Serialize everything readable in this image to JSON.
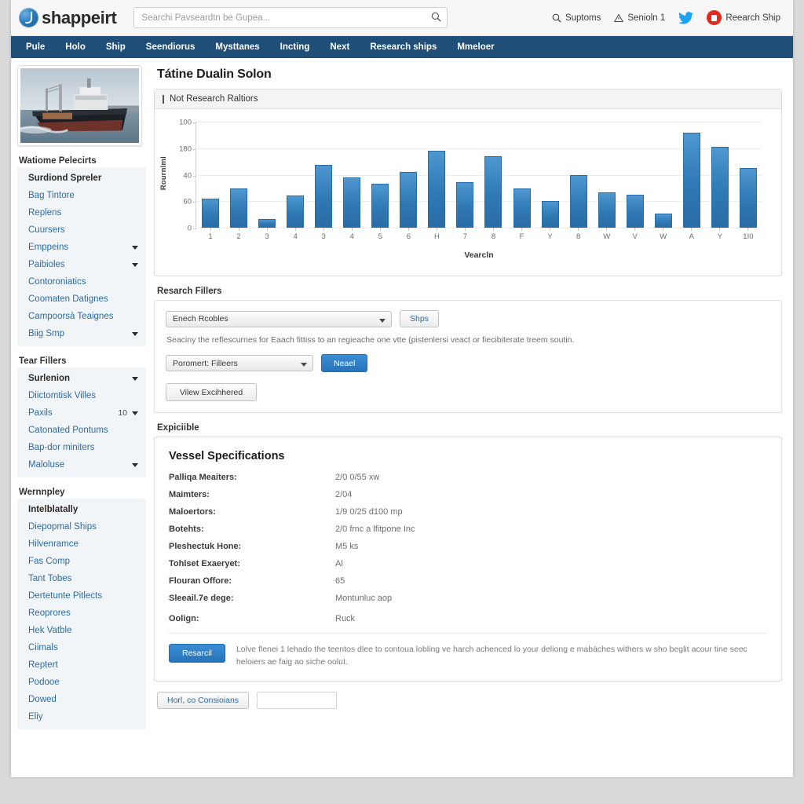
{
  "header": {
    "brand": "shappeirt",
    "search_placeholder": "Searchi Pavseardtn be Gupea...",
    "right_items": [
      {
        "icon": "search-icon",
        "label": "Suptoms"
      },
      {
        "icon": "alert-icon",
        "label": "Senioln 1"
      },
      {
        "icon": "twitter-icon",
        "label": ""
      },
      {
        "icon": "avatar-icon",
        "label": "Reearch Ship"
      }
    ]
  },
  "nav": {
    "items": [
      "Pule",
      "Holo",
      "Ship",
      "Seendiorus",
      "Mysttanes",
      "Incting",
      "Next",
      "Research ships",
      "Mmeloer"
    ]
  },
  "sidebar": {
    "thumbnail_alt": "cargo-ship-photo",
    "groups": [
      {
        "title": "Watiome Pelecirts",
        "items": [
          {
            "label": "Surdiond Spreler",
            "active": true,
            "caret": false,
            "badge": ""
          },
          {
            "label": "Bag Tintore",
            "active": false,
            "caret": false,
            "badge": ""
          },
          {
            "label": "Replens",
            "active": false,
            "caret": false,
            "badge": ""
          },
          {
            "label": "Cuursers",
            "active": false,
            "caret": false,
            "badge": ""
          },
          {
            "label": "Emppeins",
            "active": false,
            "caret": true,
            "badge": ""
          },
          {
            "label": "Paibioles",
            "active": false,
            "caret": true,
            "badge": ""
          },
          {
            "label": "Contoroniatics",
            "active": false,
            "caret": false,
            "badge": ""
          },
          {
            "label": "Coomaten Datignes",
            "active": false,
            "caret": false,
            "badge": ""
          },
          {
            "label": "Campoorsà Teaignes",
            "active": false,
            "caret": false,
            "badge": ""
          },
          {
            "label": "Biig Smp",
            "active": false,
            "caret": true,
            "badge": ""
          }
        ]
      },
      {
        "title": "Tear Fillers",
        "items": [
          {
            "label": "Surlenion",
            "active": true,
            "caret": true,
            "badge": ""
          },
          {
            "label": "Diictomtisk Villes",
            "active": false,
            "caret": false,
            "badge": ""
          },
          {
            "label": "Paxils",
            "active": false,
            "caret": true,
            "badge": "10"
          },
          {
            "label": "Catonated Pontums",
            "active": false,
            "caret": false,
            "badge": ""
          },
          {
            "label": "Bap-dor miniters",
            "active": false,
            "caret": false,
            "badge": ""
          },
          {
            "label": "Maloluse",
            "active": false,
            "caret": true,
            "badge": ""
          }
        ]
      },
      {
        "title": "Wernnpley",
        "items": [
          {
            "label": "Intelblatally",
            "active": true,
            "caret": false,
            "badge": ""
          },
          {
            "label": "Diepopmal Ships",
            "active": false,
            "caret": false,
            "badge": ""
          },
          {
            "label": "Hilvenramce",
            "active": false,
            "caret": false,
            "badge": ""
          },
          {
            "label": "Fas Comp",
            "active": false,
            "caret": false,
            "badge": ""
          },
          {
            "label": "Tant Tobes",
            "active": false,
            "caret": false,
            "badge": ""
          },
          {
            "label": "Dertetunte Pitlects",
            "active": false,
            "caret": false,
            "badge": ""
          },
          {
            "label": "Reoprores",
            "active": false,
            "caret": false,
            "badge": ""
          },
          {
            "label": "Hek Vatble",
            "active": false,
            "caret": false,
            "badge": ""
          },
          {
            "label": "Ciimals",
            "active": false,
            "caret": false,
            "badge": ""
          },
          {
            "label": "Reptert",
            "active": false,
            "caret": false,
            "badge": ""
          },
          {
            "label": "Podooe",
            "active": false,
            "caret": false,
            "badge": ""
          },
          {
            "label": "Dowed",
            "active": false,
            "caret": false,
            "badge": ""
          },
          {
            "label": "Eliy",
            "active": false,
            "caret": false,
            "badge": ""
          }
        ]
      }
    ]
  },
  "main": {
    "page_title": "Tátine Dualin Solon",
    "chart_panel_title": "Not Research Raltiors",
    "filters_title": "Resarch Fillers",
    "filters": {
      "select1": "Enech Rcobles",
      "button1": "Shps",
      "help": "Seaciny the reflescurries for Eaach fittiss to an regieache one vtte (pistenlersi veact or fiecibiterate treem soutin.",
      "select2": "Poromert: Filleers",
      "button2": "Neael",
      "button3": "Vilew Excihhered"
    },
    "expand_title": "Expiciible",
    "specs": {
      "heading": "Vessel Specifications",
      "rows": [
        {
          "key": "Palliqa Meaiters:",
          "value": "2/0 0/55 xw"
        },
        {
          "key": "Maimters:",
          "value": "2/04"
        },
        {
          "key": "Maloertors:",
          "value": "1/9 0/25 d100 mp"
        },
        {
          "key": "Botehts:",
          "value": "2/0 fmc a lfitpone Inc"
        },
        {
          "key": "Pleshectuk Hone:",
          "value": "M5 ks"
        },
        {
          "key": "Tohlset Exaeryet:",
          "value": "Al"
        },
        {
          "key": "Flouran Offore:",
          "value": "65"
        },
        {
          "key": "Sleeail.7e dege:",
          "value": "Montunluc aop"
        },
        {
          "key": "Oolign:",
          "value": "Ruck"
        }
      ]
    },
    "cta": {
      "button": "Resarcil",
      "text": "Lolve flenei 1 lehado the teentos dlee to contoua lobling ve harch achenced lo your deliong e mabàches withers w sho beglit acour tine seec heloiers ae faig ao siche ooluI."
    },
    "footer": {
      "button": "Horl, co Consioians",
      "input_value": ""
    }
  },
  "chart_data": {
    "type": "bar",
    "title": "Not Research Raltiors",
    "xlabel": "Vearcln",
    "ylabel": "Rournlml",
    "categories": [
      "1",
      "2",
      "3",
      "4",
      "3",
      "4",
      "5",
      "6",
      "H",
      "7",
      "8",
      "F",
      "Y",
      "8",
      "W",
      "V",
      "W",
      "A",
      "Y",
      "1I0"
    ],
    "values": [
      27,
      37,
      8,
      30,
      59,
      47,
      41,
      52,
      72,
      43,
      67,
      37,
      25,
      49,
      33,
      31,
      13,
      89,
      76,
      56
    ],
    "yticks": [
      "100",
      "180",
      "40",
      "60",
      "0"
    ],
    "ylim": [
      0,
      100
    ],
    "grid": true,
    "legend": "none",
    "bar_color": "#2f79b5"
  },
  "colors": {
    "nav_bg": "#1f4e79",
    "link": "#2d6ca2",
    "primary_button": "#2574bb",
    "avatar_red": "#dd2c1e",
    "twitter_blue": "#1da1f2"
  }
}
